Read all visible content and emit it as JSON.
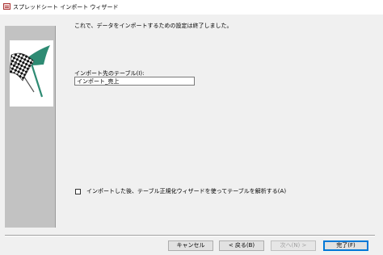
{
  "window": {
    "title": "スプレッドシート インポート ウィザード",
    "icon": "access-table-icon"
  },
  "wizard": {
    "intro": "これで、データをインポートするための設定は終了しました。",
    "table_label": "インポート先のテーブル(I):",
    "table_value": "インポート_売上",
    "analyze_checked": false,
    "analyze_label": "インポートした後、テーブル正規化ウィザードを使ってテーブルを解析する(A)"
  },
  "buttons": {
    "cancel": "キャンセル",
    "back": "< 戻る(B)",
    "next": "次へ(N) >",
    "finish": "完了(F)"
  },
  "colors": {
    "side_panel": "#c2c2c2",
    "flag_pole": "#2e8b73",
    "accent": "#0078d7"
  }
}
